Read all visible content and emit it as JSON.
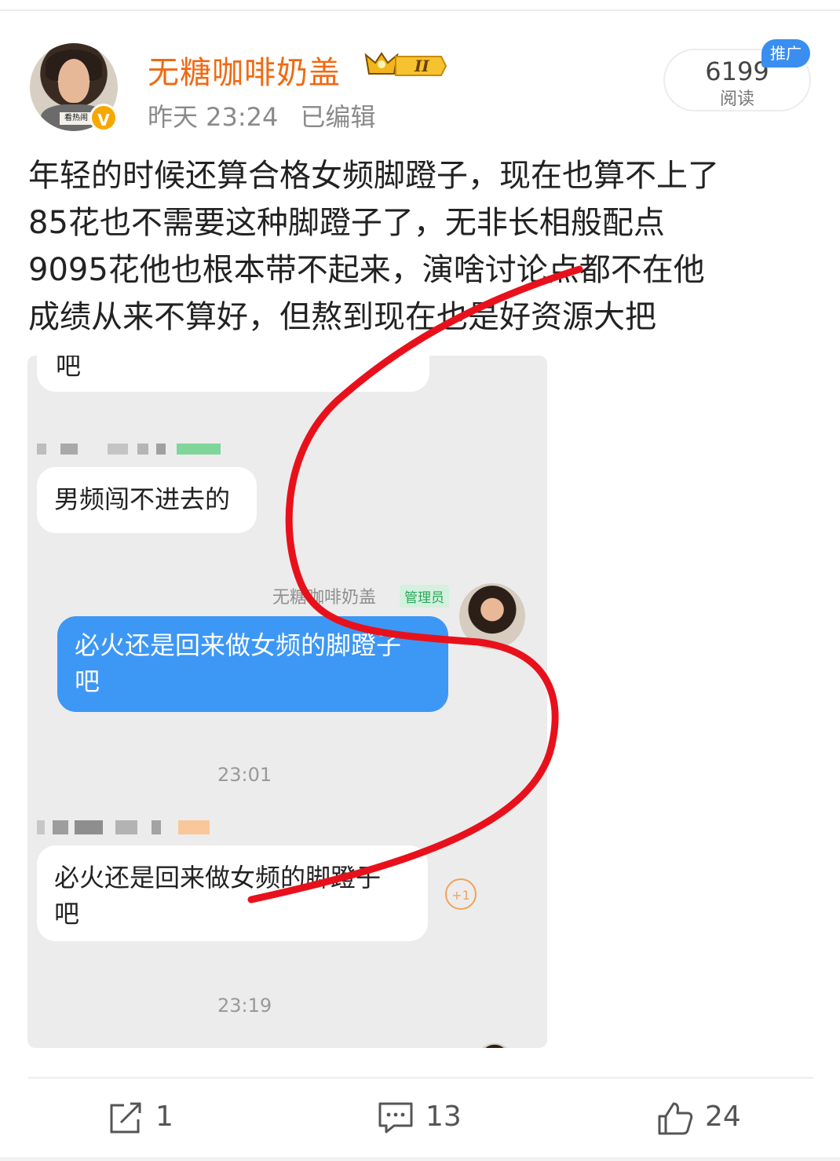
{
  "author": {
    "name": "无糖咖啡奶盖",
    "avatar_caption": "看热闹",
    "level_badge": "II",
    "verified_icon": "V"
  },
  "meta": {
    "time": "昨天 23:24",
    "edited": "已编辑"
  },
  "stats": {
    "read_count": "6199",
    "read_label": "阅读",
    "promo": "推广"
  },
  "post": {
    "lines": [
      "年轻的时候还算合格女频脚蹬子，现在也算不上了",
      "85花也不需要这种脚蹬子了，无非长相般配点",
      "9095花他也根本带不起来，演啥讨论点都不在他",
      "成绩从来不算好，但熬到现在也是好资源大把"
    ]
  },
  "chat": {
    "top_fragment": "吧",
    "msg1": "男频闯不进去的",
    "admin_name": "无糖咖啡奶盖",
    "admin_tag": "管理员",
    "msg2_line1": "必火还是回来做女频的脚蹬子",
    "msg2_line2": "吧",
    "time1": "23:01",
    "msg3_line1": "必火还是回来做女频的脚蹬子",
    "msg3_line2": "吧",
    "plus_one": "+1",
    "time2": "23:19"
  },
  "actions": {
    "share_icon": "share-icon",
    "share_count": "1",
    "comment_icon": "comment-icon",
    "comment_count": "13",
    "like_icon": "thumbs-up-icon",
    "like_count": "24"
  },
  "colors": {
    "username": "#f06a13",
    "blue_bubble": "#3d97f5",
    "annotation_red": "#e8111b",
    "promo_blue": "#3a8ef0"
  }
}
